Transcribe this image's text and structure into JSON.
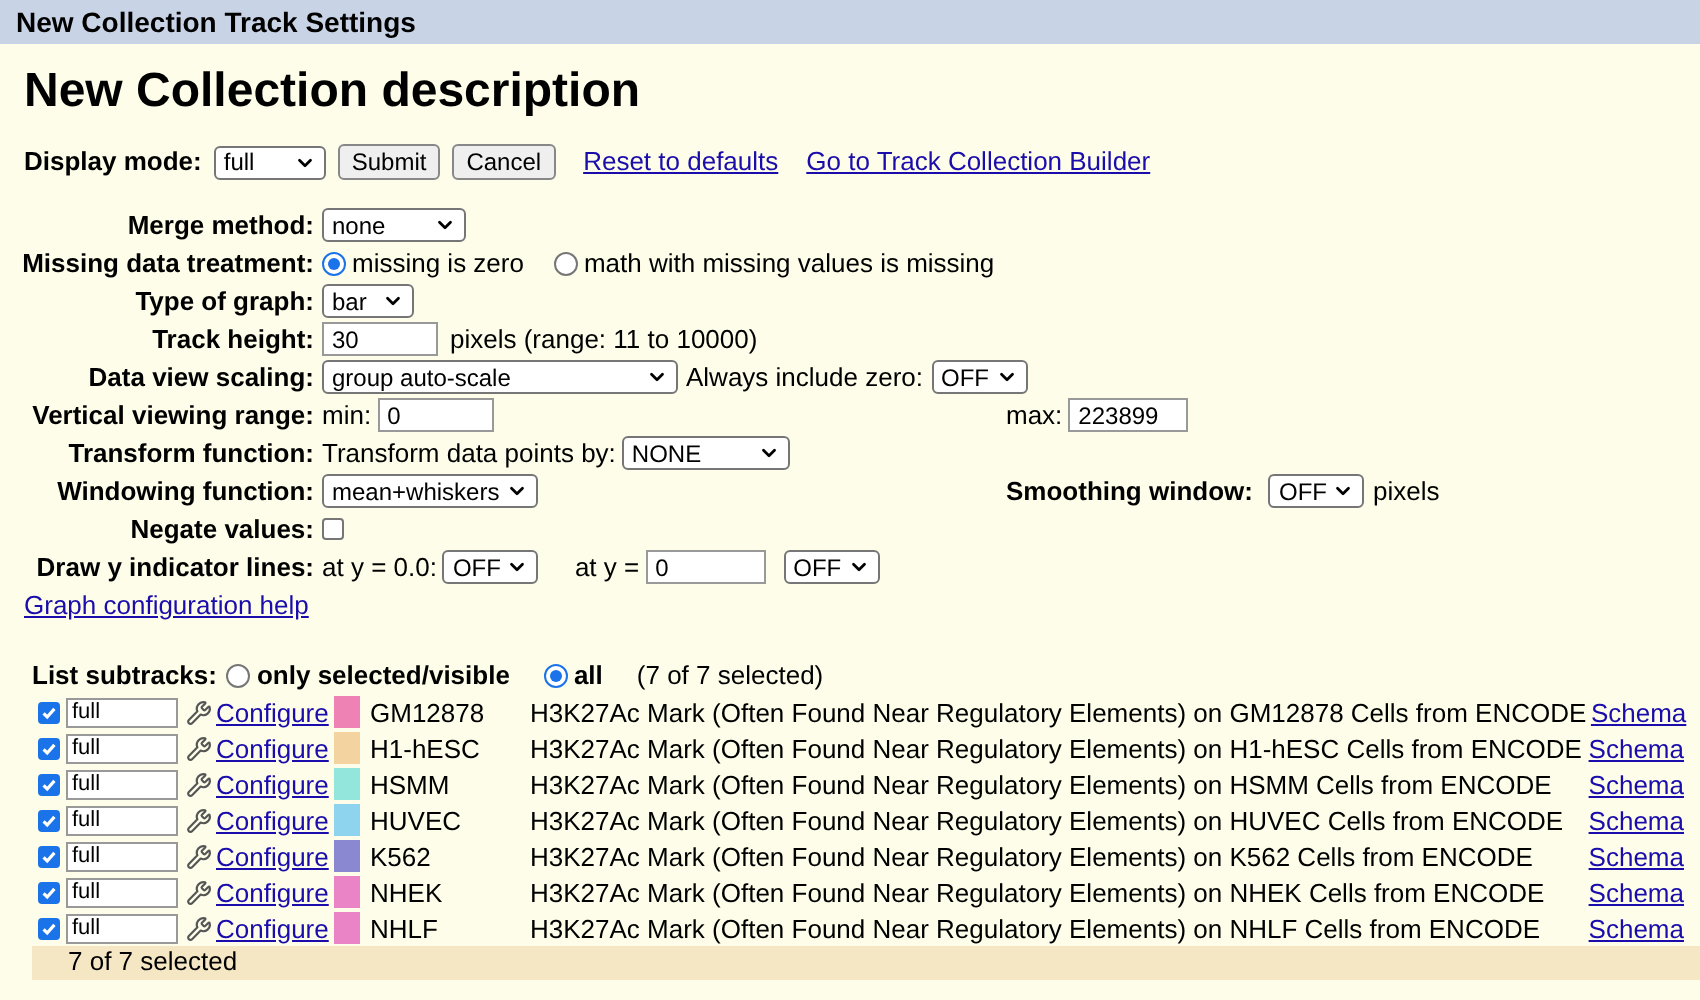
{
  "window": {
    "title": "New Collection Track Settings"
  },
  "heading": "New Collection description",
  "display_mode": {
    "label": "Display mode:",
    "value": "full"
  },
  "buttons": [
    "Submit",
    "Cancel"
  ],
  "links": [
    "Reset to defaults",
    "Go to Track Collection Builder"
  ],
  "merge_method": {
    "label": "Merge method:",
    "value": "none"
  },
  "missing_data": {
    "label": "Missing data treatment:",
    "options": [
      {
        "label": "missing is zero",
        "selected": true
      },
      {
        "label": "math with missing values is missing",
        "selected": false
      }
    ]
  },
  "graph_type": {
    "label": "Type of graph:",
    "value": "bar"
  },
  "track_height": {
    "label": "Track height:",
    "value": "30",
    "note": "pixels (range: 11 to 10000)"
  },
  "data_view_scaling": {
    "label": "Data view scaling:",
    "value": "group auto-scale",
    "zero_label": "Always include zero:",
    "zero_value": "OFF"
  },
  "vertical_range": {
    "label": "Vertical viewing range:",
    "min_label": "min:",
    "min": "0",
    "max_label": "max:",
    "max": "223899"
  },
  "transform": {
    "label": "Transform function:",
    "text": "Transform data points by:",
    "value": "NONE"
  },
  "windowing": {
    "label": "Windowing function:",
    "value": "mean+whiskers",
    "smoothing_label": "Smoothing window:",
    "smoothing_value": "OFF",
    "smoothing_unit": "pixels"
  },
  "negate": {
    "label": "Negate values:",
    "checked": false
  },
  "indicator_lines": {
    "label": "Draw y indicator lines:",
    "at_label_1": "at y = 0.0:",
    "value_1": "OFF",
    "at_label_2": "at y =",
    "input": "0",
    "value_2": "OFF"
  },
  "help_link": "Graph configuration help",
  "subtracks": {
    "label": "List subtracks:",
    "options": [
      {
        "label": "only selected/visible",
        "selected": false
      },
      {
        "label": "all",
        "selected": true
      }
    ],
    "count": "(7 of 7 selected)",
    "rows": [
      {
        "checked": true,
        "mode": "full",
        "configure": "Configure",
        "color": "#ee82b4",
        "name": "GM12878",
        "description": "H3K27Ac Mark (Often Found Near Regulatory Elements) on GM12878 Cells from ENCODE",
        "schema": "Schema"
      },
      {
        "checked": true,
        "mode": "full",
        "configure": "Configure",
        "color": "#f3d3a0",
        "name": "H1-hESC",
        "description": "H3K27Ac Mark (Often Found Near Regulatory Elements) on H1-hESC Cells from ENCODE",
        "schema": "Schema"
      },
      {
        "checked": true,
        "mode": "full",
        "configure": "Configure",
        "color": "#93e6dc",
        "name": "HSMM",
        "description": "H3K27Ac Mark (Often Found Near Regulatory Elements) on HSMM Cells from ENCODE",
        "schema": "Schema"
      },
      {
        "checked": true,
        "mode": "full",
        "configure": "Configure",
        "color": "#8fd4ee",
        "name": "HUVEC",
        "description": "H3K27Ac Mark (Often Found Near Regulatory Elements) on HUVEC Cells from ENCODE",
        "schema": "Schema"
      },
      {
        "checked": true,
        "mode": "full",
        "configure": "Configure",
        "color": "#8b88d2",
        "name": "K562",
        "description": "H3K27Ac Mark (Often Found Near Regulatory Elements) on K562 Cells from ENCODE",
        "schema": "Schema"
      },
      {
        "checked": true,
        "mode": "full",
        "configure": "Configure",
        "color": "#ea84c6",
        "name": "NHEK",
        "description": "H3K27Ac Mark (Often Found Near Regulatory Elements) on NHEK Cells from ENCODE",
        "schema": "Schema"
      },
      {
        "checked": true,
        "mode": "full",
        "configure": "Configure",
        "color": "#ea84c6",
        "name": "NHLF",
        "description": "H3K27Ac Mark (Often Found Near Regulatory Elements) on NHLF Cells from ENCODE",
        "schema": "Schema"
      }
    ],
    "footer": "7 of 7 selected"
  }
}
